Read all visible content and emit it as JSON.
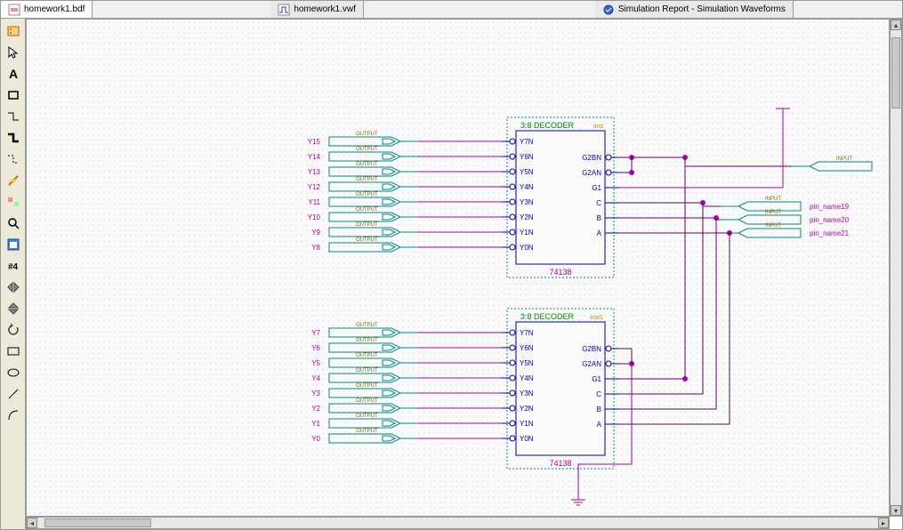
{
  "tabs": [
    {
      "label": "homework1.bdf",
      "icon": "bdf"
    },
    {
      "label": "homework1.vwf",
      "icon": "vwf"
    },
    {
      "label": "Simulation Report - Simulation Waveforms",
      "icon": "sim"
    }
  ],
  "tools": [
    {
      "name": "symbol-tool",
      "icon": "symbol"
    },
    {
      "name": "selection-tool",
      "icon": "pointer"
    },
    {
      "name": "text-tool",
      "icon": "text"
    },
    {
      "name": "block-tool",
      "icon": "block"
    },
    {
      "name": "orthogonal-node-tool",
      "icon": "orth-node"
    },
    {
      "name": "orthogonal-bus-tool",
      "icon": "orth-bus"
    },
    {
      "name": "conduit-tool",
      "icon": "conduit"
    },
    {
      "name": "rubberband-tool",
      "icon": "rubber"
    },
    {
      "name": "partial-line-tool",
      "icon": "partial"
    },
    {
      "name": "zoom-tool",
      "icon": "zoom"
    },
    {
      "name": "full-screen-tool",
      "icon": "fullscreen"
    },
    {
      "name": "find-tool",
      "icon": "find"
    },
    {
      "name": "flip-horizontal-tool",
      "icon": "flip-h"
    },
    {
      "name": "flip-vertical-tool",
      "icon": "flip-v"
    },
    {
      "name": "rotate-left-tool",
      "icon": "rotate"
    },
    {
      "name": "rectangle-tool",
      "icon": "rect"
    },
    {
      "name": "oval-tool",
      "icon": "oval"
    },
    {
      "name": "line-tool",
      "icon": "line"
    },
    {
      "name": "arc-tool",
      "icon": "arc"
    }
  ],
  "decoder1": {
    "title": "3:8 DECODER",
    "name": "74138",
    "inst": "inst",
    "outs": [
      "Y7N",
      "Y6N",
      "Y5N",
      "Y4N",
      "Y3N",
      "Y2N",
      "Y1N",
      "Y0N"
    ],
    "ins": [
      "G2BN",
      "G2AN",
      "G1",
      "C",
      "B",
      "A"
    ]
  },
  "decoder2": {
    "title": "3:8 DECODER",
    "name": "74138",
    "inst": "inst1",
    "outs": [
      "Y7N",
      "Y6N",
      "Y5N",
      "Y4N",
      "Y3N",
      "Y2N",
      "Y1N",
      "Y0N"
    ],
    "ins": [
      "G2BN",
      "G2AN",
      "G1",
      "C",
      "B",
      "A"
    ]
  },
  "outputs_top": [
    "Y15",
    "Y14",
    "Y13",
    "Y12",
    "Y11",
    "Y10",
    "Y9",
    "Y8"
  ],
  "outputs_bot": [
    "Y7",
    "Y6",
    "Y5",
    "Y4",
    "Y3",
    "Y2",
    "Y1",
    "Y0"
  ],
  "output_label": "OUTPUT",
  "input_label": "INPUT",
  "input_name_main": "",
  "input_pins": [
    "pin_name19",
    "pin_name20",
    "pin_name21"
  ],
  "colors": {
    "wire": "#aa00aa",
    "darkwire": "#660066",
    "decoder_border": "#008888",
    "text_pin": "#0000aa",
    "text_title": "#008800",
    "text_inst": "#cc8800",
    "pin_brown": "#886600",
    "node": "#aa00aa"
  }
}
